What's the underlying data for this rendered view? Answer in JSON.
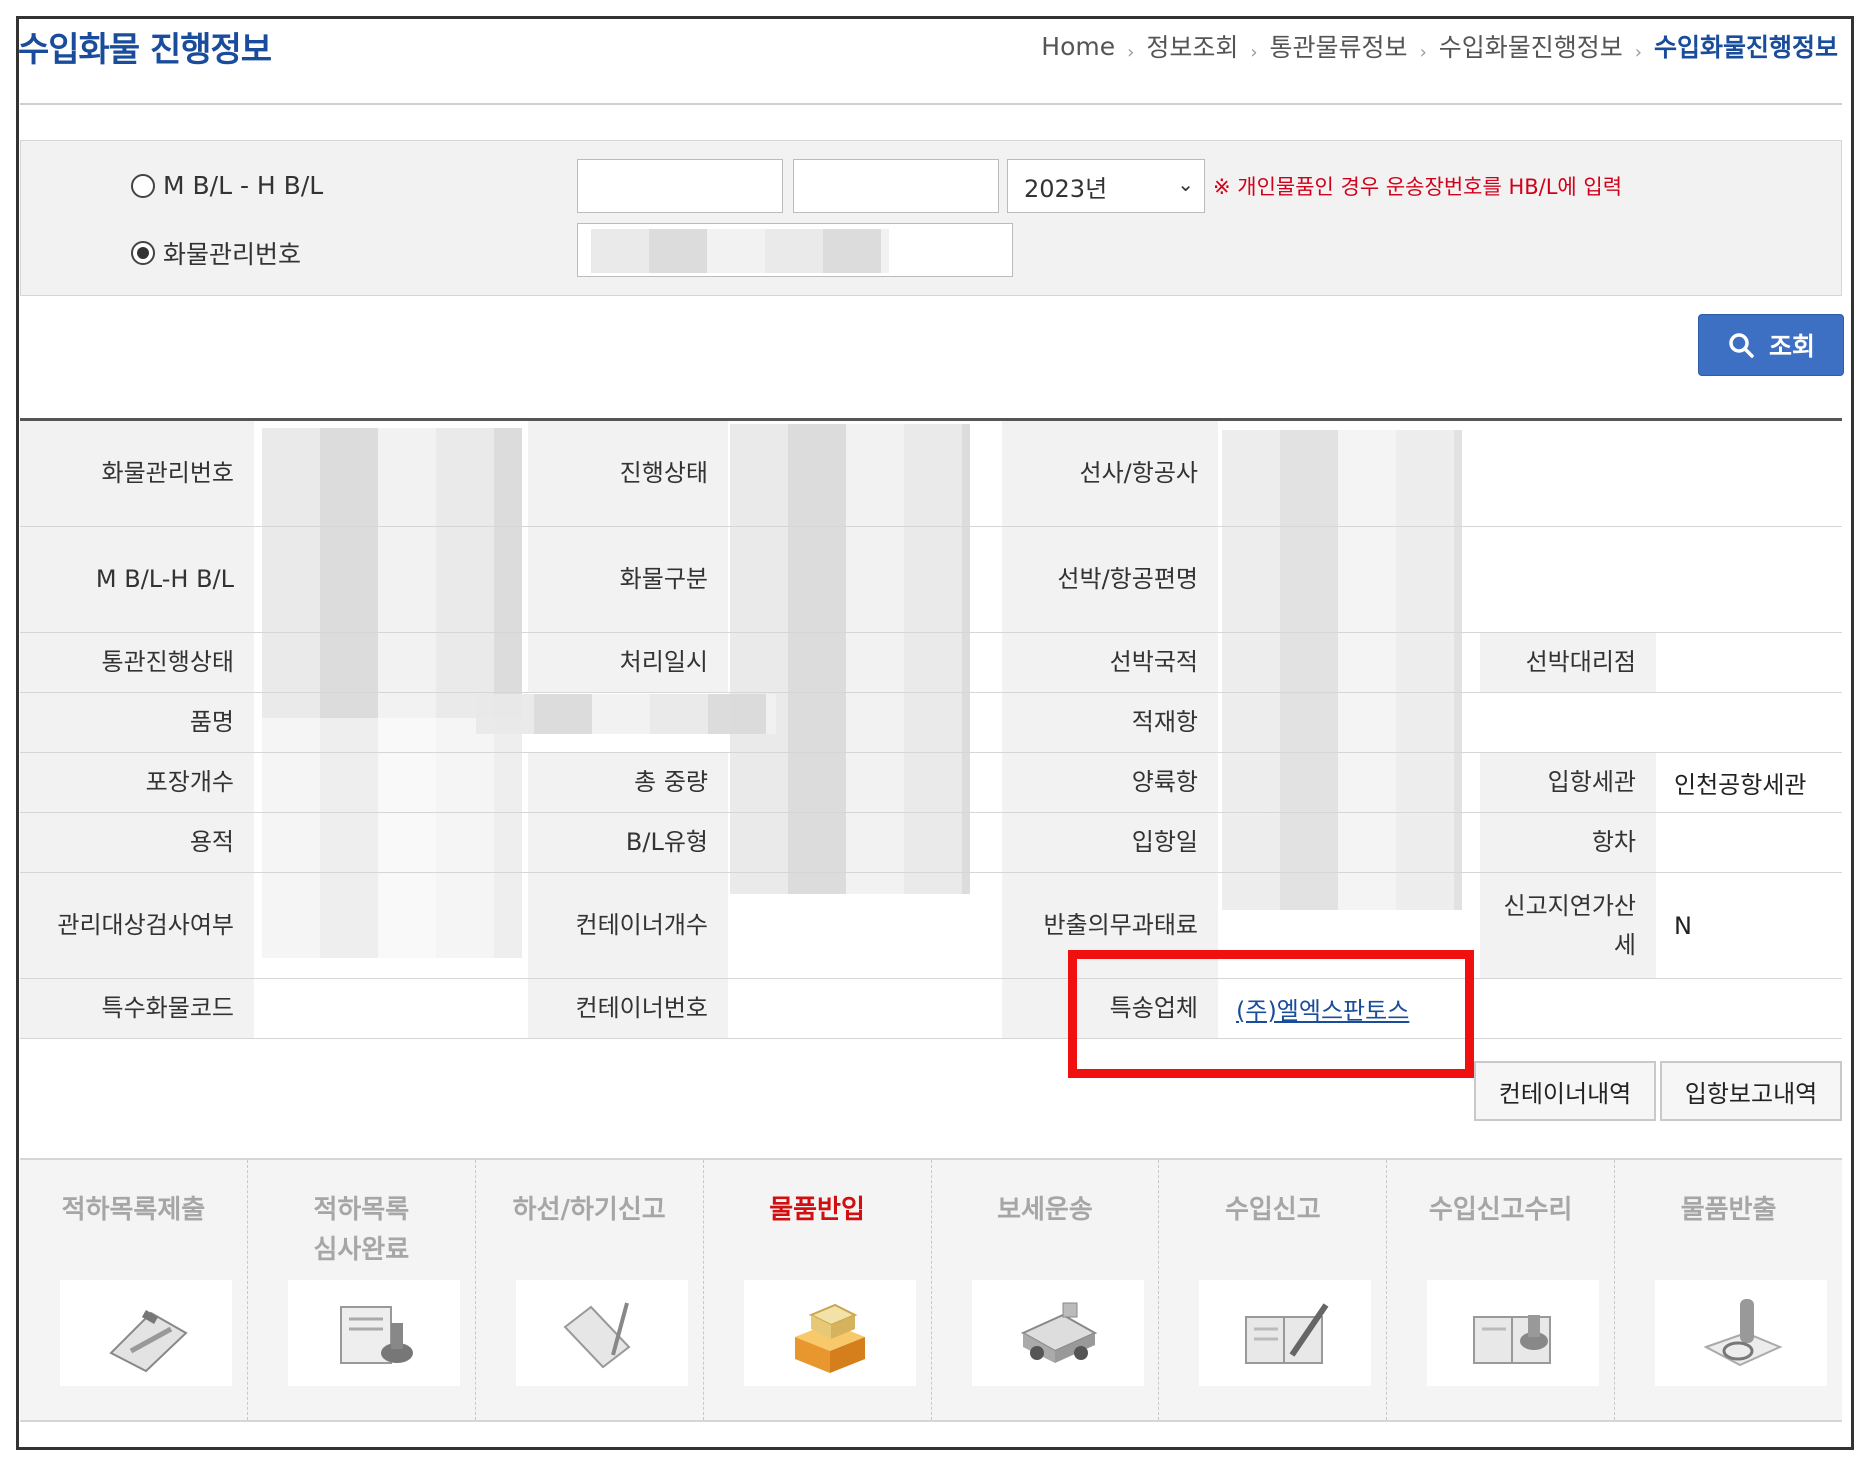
{
  "header": {
    "title": "수입화물 진행정보",
    "breadcrumb": [
      "Home",
      "정보조회",
      "통관물류정보",
      "수입화물진행정보",
      "수입화물진행정보"
    ]
  },
  "search": {
    "radio_mbl": "M B/L - H B/L",
    "radio_cargo": "화물관리번호",
    "selected_radio": "화물관리번호",
    "mbl_value": "",
    "hbl_value": "",
    "year_select": "2023년",
    "notice": "※ 개인물품인 경우 운송장번호를 HB/L에 입력",
    "cargo_value": "",
    "search_button": "조회"
  },
  "info": {
    "labels": {
      "cargo_no": "화물관리번호",
      "status": "진행상태",
      "carrier": "선사/항공사",
      "mbl_hbl": "M B/L-H B/L",
      "cargo_type": "화물구분",
      "vessel": "선박/항공편명",
      "customs_status": "통관진행상태",
      "process_datetime": "처리일시",
      "vessel_nation": "선박국적",
      "vessel_agent": "선박대리점",
      "item_name": "품명",
      "loading_port": "적재항",
      "package_count": "포장개수",
      "total_weight": "총 중량",
      "unloading_port": "양륙항",
      "entry_customs": "입항세관",
      "volume": "용적",
      "bl_type": "B/L유형",
      "entry_date": "입항일",
      "voyage": "항차",
      "inspection": "관리대상검사여부",
      "container_count": "컨테이너개수",
      "release_penalty": "반출의무과태료",
      "late_report_tax": "신고지연가산세",
      "special_code": "특수화물코드",
      "container_no": "컨테이너번호",
      "courier": "특송업체"
    },
    "values": {
      "entry_customs": "인천공항세관",
      "late_report_tax": "N",
      "courier": "(주)엘엑스판토스"
    }
  },
  "buttons": {
    "container_history": "컨테이너내역",
    "entry_report_history": "입항보고내역"
  },
  "steps": [
    {
      "label": "적하목록제출",
      "icon": "clipboard-icon",
      "active": false
    },
    {
      "label": "적하목록\n심사완료",
      "icon": "stamp-document-icon",
      "active": false
    },
    {
      "label": "하선/하기신고",
      "icon": "open-book-pen-icon",
      "active": false
    },
    {
      "label": "물품반입",
      "icon": "package-box-icon",
      "active": true
    },
    {
      "label": "보세운송",
      "icon": "truck-icon",
      "active": false
    },
    {
      "label": "수입신고",
      "icon": "notebook-pen-icon",
      "active": false
    },
    {
      "label": "수입신고수리",
      "icon": "notebook-stamp-icon",
      "active": false
    },
    {
      "label": "물품반출",
      "icon": "release-stamp-icon",
      "active": false
    }
  ],
  "colors": {
    "title_blue": "#1a4c9c",
    "button_blue": "#3d6fc2",
    "highlight_red": "#f01010",
    "active_step_red": "#d01010"
  }
}
